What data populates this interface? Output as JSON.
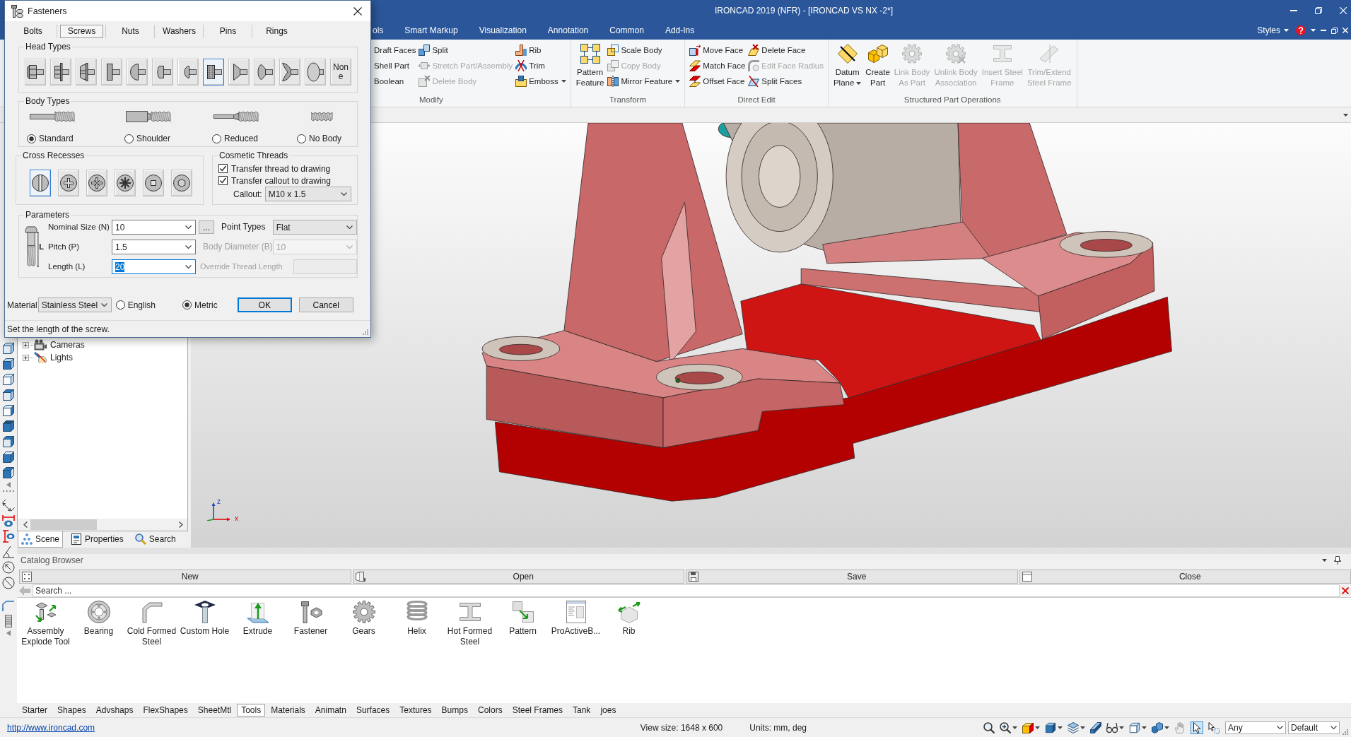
{
  "window": {
    "title": "IRONCAD 2019 (NFR) - [IRONCAD VS NX -2*]"
  },
  "menu_bar": {
    "tabs": [
      "ols",
      "Smart Markup",
      "Visualization",
      "Annotation",
      "Common",
      "Add-Ins"
    ],
    "styles_menu": "Styles"
  },
  "ribbon": {
    "groups": [
      {
        "label": "Modify",
        "columns": [
          [
            {
              "label": "Draft Faces",
              "kind": "small",
              "disabled": false,
              "dropdown": false
            },
            {
              "label": "Shell Part",
              "kind": "small",
              "disabled": false,
              "dropdown": false
            },
            {
              "label": "Boolean",
              "kind": "small",
              "disabled": false,
              "dropdown": false
            }
          ],
          [
            {
              "label": "Split",
              "kind": "small",
              "disabled": false,
              "dropdown": false
            },
            {
              "label": "Stretch Part/Assembly",
              "kind": "small",
              "disabled": true,
              "dropdown": false
            },
            {
              "label": "Delete Body",
              "kind": "small",
              "disabled": true,
              "dropdown": false
            }
          ],
          [
            {
              "label": "Rib",
              "kind": "small",
              "disabled": false,
              "dropdown": false
            },
            {
              "label": "Trim",
              "kind": "small",
              "disabled": false,
              "dropdown": false
            },
            {
              "label": "Emboss",
              "kind": "small",
              "disabled": false,
              "dropdown": true
            }
          ]
        ]
      },
      {
        "label": "Transform",
        "columns": [
          [
            {
              "label": "Pattern\nFeature",
              "kind": "large",
              "disabled": false,
              "dropdown": false
            }
          ],
          [
            {
              "label": "Scale Body",
              "kind": "small",
              "disabled": false,
              "dropdown": false
            },
            {
              "label": "Copy Body",
              "kind": "small",
              "disabled": true,
              "dropdown": false
            },
            {
              "label": "Mirror Feature",
              "kind": "small",
              "disabled": false,
              "dropdown": true
            }
          ]
        ]
      },
      {
        "label": "Direct Edit",
        "columns": [
          [
            {
              "label": "Move Face",
              "kind": "small",
              "disabled": false,
              "dropdown": false
            },
            {
              "label": "Match Face",
              "kind": "small",
              "disabled": false,
              "dropdown": false
            },
            {
              "label": "Offset Face",
              "kind": "small",
              "disabled": false,
              "dropdown": false
            }
          ],
          [
            {
              "label": "Delete Face",
              "kind": "small",
              "disabled": false,
              "dropdown": false
            },
            {
              "label": "Edit Face Radius",
              "kind": "small",
              "disabled": true,
              "dropdown": false
            },
            {
              "label": "Split Faces",
              "kind": "small",
              "disabled": false,
              "dropdown": false
            }
          ]
        ]
      },
      {
        "label": "Structured Part Operations",
        "columns": [
          [
            {
              "label": "Datum\nPlane",
              "kind": "large",
              "disabled": false,
              "dropdown": true
            }
          ],
          [
            {
              "label": "Create\nPart",
              "kind": "large",
              "disabled": false,
              "dropdown": false
            }
          ],
          [
            {
              "label": "Link Body\nAs Part",
              "kind": "large",
              "disabled": true,
              "dropdown": false
            }
          ],
          [
            {
              "label": "Unlink Body\nAssociation",
              "kind": "large",
              "disabled": true,
              "dropdown": false
            }
          ],
          [
            {
              "label": "Insert Steel\nFrame",
              "kind": "large",
              "disabled": true,
              "dropdown": false
            }
          ],
          [
            {
              "label": "Trim/Extend\nSteel Frame",
              "kind": "large",
              "disabled": true,
              "dropdown": false
            }
          ]
        ]
      }
    ]
  },
  "dialog": {
    "title": "Fasteners",
    "tabs": [
      {
        "label": "Bolts",
        "selected": false
      },
      {
        "label": "Screws",
        "selected": true
      },
      {
        "label": "Nuts",
        "selected": false
      },
      {
        "label": "Washers",
        "selected": false
      },
      {
        "label": "Pins",
        "selected": false
      },
      {
        "label": "Rings",
        "selected": false
      }
    ],
    "head_types": {
      "label": "Head Types",
      "options": [
        {
          "kind": "icon",
          "selected": false
        },
        {
          "kind": "icon",
          "selected": false
        },
        {
          "kind": "icon",
          "selected": false
        },
        {
          "kind": "icon",
          "selected": false
        },
        {
          "kind": "icon",
          "selected": false
        },
        {
          "kind": "icon",
          "selected": false
        },
        {
          "kind": "icon",
          "selected": false
        },
        {
          "kind": "icon",
          "selected": true
        },
        {
          "kind": "icon",
          "selected": false
        },
        {
          "kind": "icon",
          "selected": false
        },
        {
          "kind": "icon",
          "selected": false
        },
        {
          "kind": "icon",
          "selected": false
        },
        {
          "kind": "text",
          "label": "None",
          "selected": false
        }
      ]
    },
    "body_types": {
      "label": "Body Types",
      "options": [
        {
          "label": "Standard",
          "selected": true
        },
        {
          "label": "Shoulder",
          "selected": false
        },
        {
          "label": "Reduced",
          "selected": false
        },
        {
          "label": "No Body",
          "selected": false
        }
      ]
    },
    "cross_recesses": {
      "label": "Cross Recesses",
      "options": [
        {
          "selected": true
        },
        {
          "selected": false
        },
        {
          "selected": false
        },
        {
          "selected": false
        },
        {
          "selected": false
        },
        {
          "selected": false
        }
      ]
    },
    "cosmetic_threads": {
      "label": "Cosmetic Threads",
      "options": [
        {
          "label": "Transfer thread to drawing",
          "checked": true
        },
        {
          "label": "Transfer callout to drawing",
          "checked": true
        }
      ],
      "callout": {
        "label": "Callout:",
        "value": "M10 x 1.5"
      }
    },
    "parameters": {
      "label": "Parameters",
      "drawing_label": "L",
      "fields": [
        {
          "label": "Nominal Size (N)",
          "value": "10",
          "focused": false
        },
        {
          "label": "Pitch (P)",
          "value": "1.5",
          "focused": false
        },
        {
          "label": "Length (L)",
          "value": "20",
          "focused": true
        }
      ],
      "browse_button": "...",
      "side_fields": [
        {
          "kind": "dropdown",
          "label": "Point Types",
          "value": "Flat",
          "disabled": false
        },
        {
          "kind": "dropdown",
          "label": "Body Diameter (B)",
          "value": "10",
          "disabled": true
        },
        {
          "kind": "text",
          "label": "Override Thread Length",
          "disabled": true
        }
      ]
    },
    "material": {
      "label": "Material",
      "value": "Stainless Steel"
    },
    "units": [
      {
        "label": "English",
        "selected": false
      },
      {
        "label": "Metric",
        "selected": true
      }
    ],
    "buttons": [
      {
        "label": "OK",
        "default": true
      },
      {
        "label": "Cancel",
        "default": false
      }
    ],
    "status": "Set the length of the screw."
  },
  "scene_tree": {
    "items": [
      {
        "label": "Cameras",
        "expanded": false
      },
      {
        "label": "Lights",
        "expanded": false
      }
    ]
  },
  "panel_tabs": [
    {
      "label": "Scene",
      "selected": true
    },
    {
      "label": "Properties",
      "selected": false
    },
    {
      "label": "Search",
      "selected": false
    }
  ],
  "viewport": {
    "axis_labels": [
      "z",
      "x"
    ]
  },
  "catalog_browser": {
    "title": "Catalog Browser",
    "buttons": [
      "New",
      "Open",
      "Save",
      "Close"
    ],
    "search": {
      "placeholder": "Search ..."
    },
    "items": [
      "Assembly Explode Tool",
      "Bearing",
      "Cold Formed Steel",
      "Custom Hole",
      "Extrude",
      "Fastener",
      "Gears",
      "Helix",
      "Hot Formed Steel",
      "Pattern",
      "ProActiveB...",
      "Rib"
    ],
    "tabs": [
      {
        "label": "Starter",
        "selected": false
      },
      {
        "label": "Shapes",
        "selected": false
      },
      {
        "label": "Advshaps",
        "selected": false
      },
      {
        "label": "FlexShapes",
        "selected": false
      },
      {
        "label": "SheetMtl",
        "selected": false
      },
      {
        "label": "Tools",
        "selected": true
      },
      {
        "label": "Materials",
        "selected": false
      },
      {
        "label": "Animatn",
        "selected": false
      },
      {
        "label": "Surfaces",
        "selected": false
      },
      {
        "label": "Textures",
        "selected": false
      },
      {
        "label": "Bumps",
        "selected": false
      },
      {
        "label": "Colors",
        "selected": false
      },
      {
        "label": "Steel Frames",
        "selected": false
      },
      {
        "label": "Tank",
        "selected": false
      },
      {
        "label": "joes",
        "selected": false
      }
    ]
  },
  "status_bar": {
    "link": "http://www.ironcad.com",
    "view_size": "View size: 1648 x 600",
    "units": "Units: mm, deg",
    "tools": [
      {
        "selected": false,
        "dropdown": false
      },
      {
        "selected": false,
        "dropdown": true
      },
      {
        "selected": false,
        "dropdown": true
      },
      {
        "selected": false,
        "dropdown": true
      },
      {
        "selected": false,
        "dropdown": true
      },
      {
        "selected": false,
        "dropdown": false
      },
      {
        "selected": false,
        "dropdown": true
      },
      {
        "selected": false,
        "dropdown": true
      },
      {
        "selected": false,
        "dropdown": true
      },
      {
        "selected": false,
        "dropdown": false
      },
      {
        "selected": true,
        "dropdown": false
      },
      {
        "selected": false,
        "dropdown": false
      }
    ],
    "selectors": [
      "Any",
      "Default"
    ]
  }
}
